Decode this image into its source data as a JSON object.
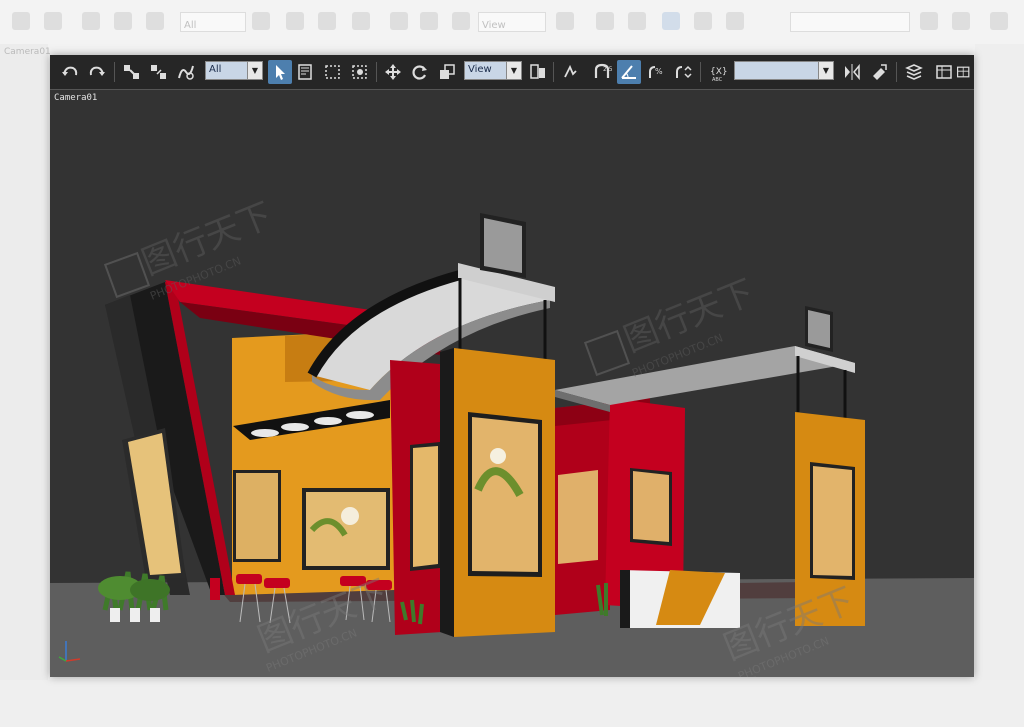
{
  "background_app": {
    "selection_filter": "All",
    "coord_system": "View",
    "side_label": "Camera01"
  },
  "toolbar": {
    "selection_filter": "All",
    "coord_system": "View",
    "named_selection": ""
  },
  "viewport": {
    "label": "Camera01",
    "background": "#333333"
  },
  "watermarks": {
    "brand": "图行天下",
    "url": "PHOTOPHOTO.CN"
  },
  "colors": {
    "toolbar_bg": "#262626",
    "active_tool": "#4d7fae",
    "booth_red": "#b0001a",
    "booth_orange": "#d68a12",
    "floor": "#5e5e5e"
  }
}
